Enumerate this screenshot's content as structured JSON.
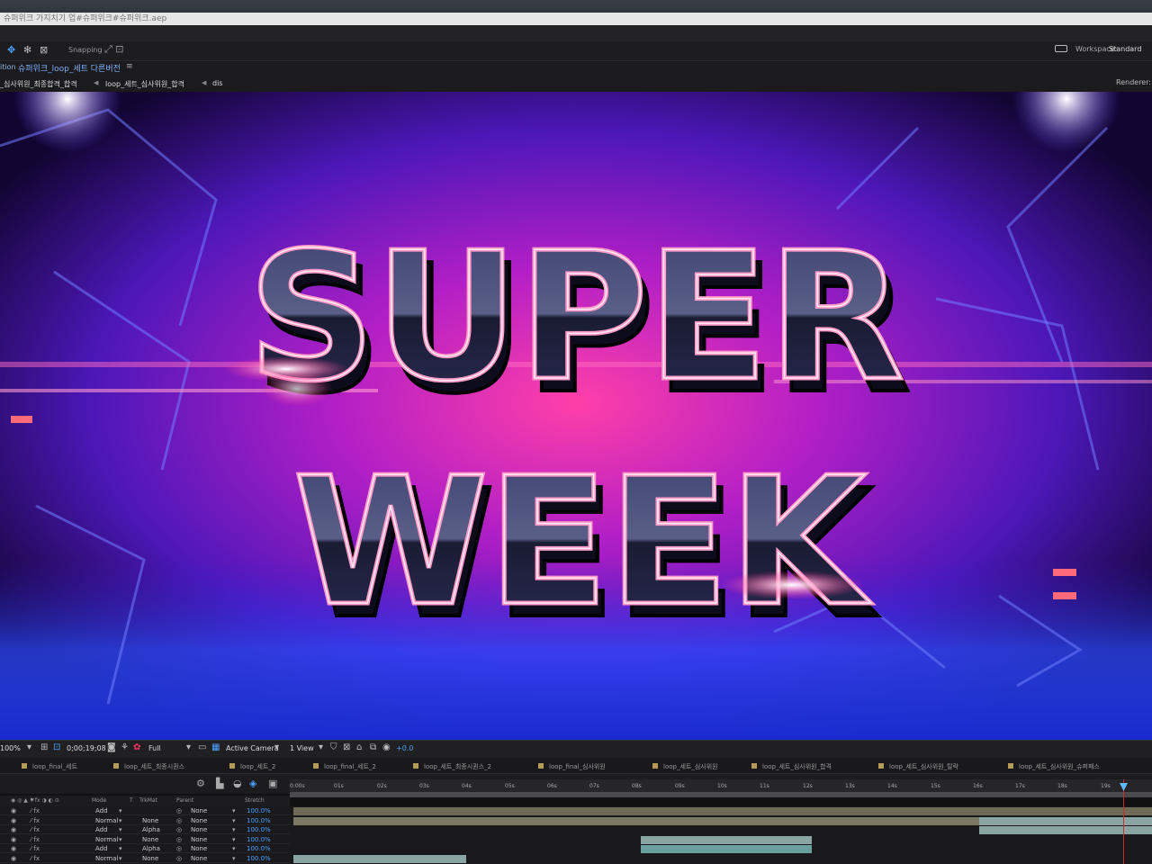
{
  "window": {
    "title": "슈퍼위크 가지치기 업#슈퍼위크#슈퍼위크.aep"
  },
  "toolbar": {
    "snapping_label": "Snapping",
    "workspace_label": "Workspace:",
    "workspace_value": "Standard"
  },
  "composition": {
    "prefix": "ition",
    "name": "슈퍼위크_loop_세트 다른버전",
    "menu_glyph": "≡"
  },
  "breadcrumbs": [
    "_심사위원_최종합격_합격",
    "loop_세트_심사위원_합격",
    "dis"
  ],
  "renderer_label": "Renderer:",
  "viewer": {
    "title_line1": "SUPER",
    "title_line2": "WEEK",
    "palette": {
      "bg_dark": "#14062e",
      "purple": "#6b1bd1",
      "magenta": "#e0208f",
      "blue": "#2a3bff",
      "pink_outline": "#ff9ac8"
    }
  },
  "viewer_bar": {
    "zoom": "100%",
    "timecode": "0;00;19;08",
    "resolution": "Full",
    "camera": "Active Camera",
    "views": "1 View",
    "exposure": "+0.0"
  },
  "tabs": [
    "loop_final_세트",
    "loop_세트_최종시퀀스",
    "loop_세트_2",
    "loop_final_세트_2",
    "loop_세트_최종시퀀스_2",
    "loop_final_심사위원",
    "loop_세트_심사위원",
    "loop_세트_심사위원_합격",
    "loop_세트_심사위원_탈락",
    "loop_세트_심사위원_슈퍼패스"
  ],
  "ruler_ticks": [
    "0:00s",
    "01s",
    "02s",
    "03s",
    "04s",
    "05s",
    "06s",
    "07s",
    "08s",
    "09s",
    "10s",
    "11s",
    "12s",
    "13s",
    "14s",
    "15s",
    "16s",
    "17s",
    "18s",
    "19s"
  ],
  "columns": {
    "mode": "Mode",
    "t": "T",
    "trkmat": "TrkMat",
    "parent": "Parent",
    "stretch": "Stretch"
  },
  "layers": [
    {
      "mode": "Add",
      "trkmat": "",
      "parent": "None",
      "stretch": "100.0%"
    },
    {
      "mode": "Normal",
      "trkmat": "None",
      "parent": "None",
      "stretch": "100.0%"
    },
    {
      "mode": "Add",
      "trkmat": "Alpha",
      "parent": "None",
      "stretch": "100.0%"
    },
    {
      "mode": "Normal",
      "trkmat": "None",
      "parent": "None",
      "stretch": "100.0%"
    },
    {
      "mode": "Add",
      "trkmat": "Alpha",
      "parent": "None",
      "stretch": "100.0%"
    },
    {
      "mode": "Normal",
      "trkmat": "None",
      "parent": "None",
      "stretch": "100.0%"
    }
  ]
}
